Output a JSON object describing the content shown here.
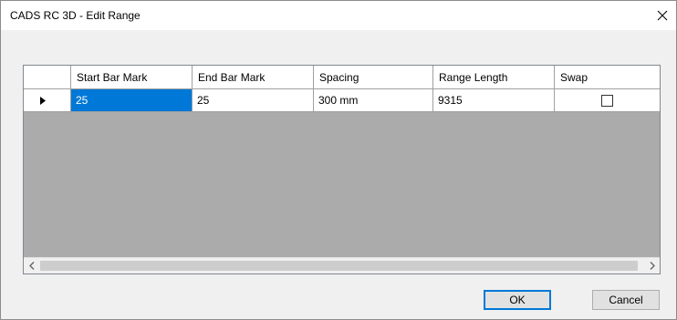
{
  "window": {
    "title": "CADS RC 3D - Edit Range",
    "close_glyph": "✕"
  },
  "grid": {
    "columns": [
      "Start Bar Mark",
      "End Bar Mark",
      "Spacing",
      "Range Length",
      "Swap"
    ],
    "rows": [
      {
        "start_bar_mark": "25",
        "end_bar_mark": "25",
        "spacing": "300 mm",
        "range_length": "9315",
        "swap": false,
        "selected_cell": "start_bar_mark",
        "row_indicator": "current-row-arrow"
      }
    ],
    "selection_color": "#0078d7",
    "empty_area_color": "#ababab"
  },
  "buttons": {
    "ok_label": "OK",
    "cancel_label": "Cancel"
  },
  "icons": {
    "close": "close-icon",
    "row_indicator": "row-indicator-arrow-icon",
    "scroll_left": "scroll-left-arrow-icon",
    "scroll_right": "scroll-right-arrow-icon"
  }
}
